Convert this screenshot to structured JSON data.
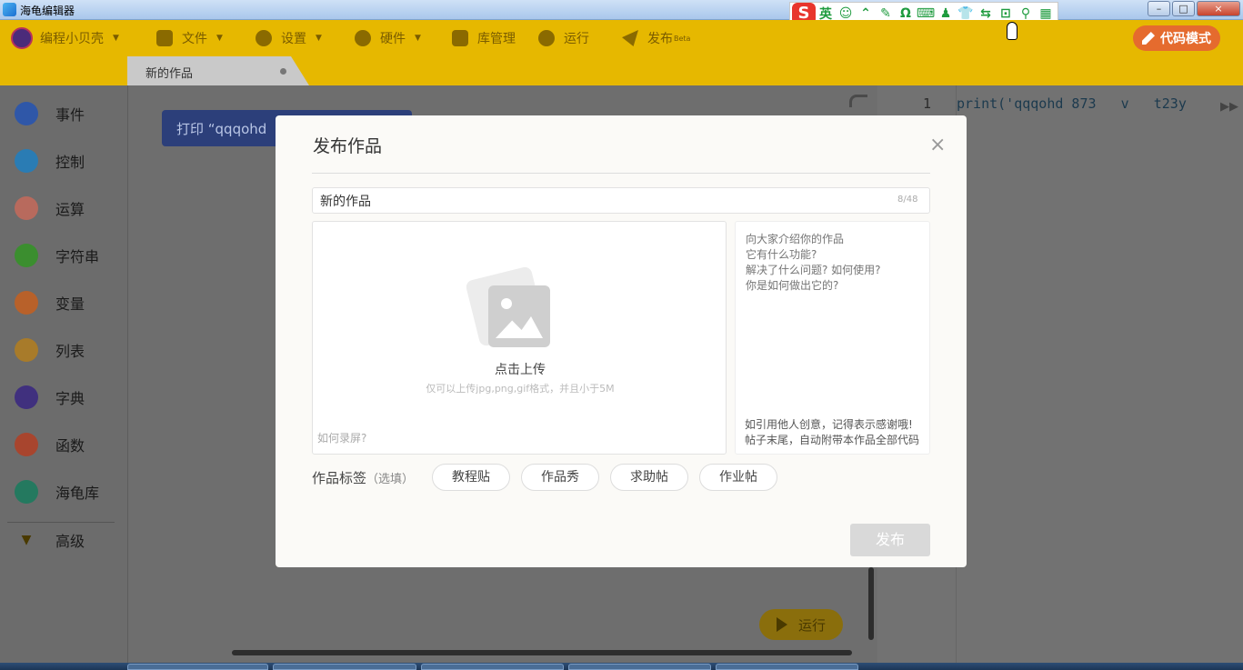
{
  "window": {
    "title": "海龟编辑器",
    "btn_min": "–",
    "btn_max": "□",
    "btn_close": "×"
  },
  "ime": {
    "logo": "S",
    "items": [
      "英",
      "☺",
      "⌃",
      "✎",
      "Ω",
      "⌨",
      "♟",
      "👕",
      "⇆",
      "⊡",
      "⚲",
      "▦"
    ]
  },
  "toolbar": {
    "user": "编程小贝壳",
    "file": "文件",
    "settings": "设置",
    "hardware": "硬件",
    "library": "库管理",
    "run": "运行",
    "publish": "发布",
    "publish_badge": "Beta",
    "code_mode": "代码模式",
    "accent": "#e6b800"
  },
  "tab": {
    "label": "新的作品"
  },
  "categories": [
    {
      "label": "事件",
      "color": "#2f57a8"
    },
    {
      "label": "控制",
      "color": "#2a7cb4"
    },
    {
      "label": "运算",
      "color": "#b86a5d"
    },
    {
      "label": "字符串",
      "color": "#3b8e2f"
    },
    {
      "label": "变量",
      "color": "#b8612a"
    },
    {
      "label": "列表",
      "color": "#a87b2a"
    },
    {
      "label": "字典",
      "color": "#40307e"
    },
    {
      "label": "函数",
      "color": "#a8452e"
    },
    {
      "label": "海龟库",
      "color": "#24795f"
    }
  ],
  "advanced": {
    "label": "高级"
  },
  "workspace": {
    "block_text": "打印 “qqqohd",
    "run_label": "运行"
  },
  "code": {
    "line": "1",
    "text": "print('qqqohd 873   v   t23y"
  },
  "modal": {
    "title": "发布作品",
    "close": "×",
    "title_value": "新的作品",
    "counter": "8/48",
    "upload_label": "点击上传",
    "upload_hint": "仅可以上传jpg,png,gif格式，并且小于5M",
    "record_link": "如何录屏?",
    "desc_placeholder": "向大家介绍你的作品\n它有什么功能?\n解决了什么问题? 如何使用?\n你是如何做出它的?",
    "desc_footer_1": "如引用他人创意，记得表示感谢哦!",
    "desc_footer_2": "帖子末尾，自动附带本作品全部代码",
    "tags_label": "作品标签",
    "tags_optional": "（选填）",
    "tags": [
      "教程贴",
      "作品秀",
      "求助帖",
      "作业帖"
    ],
    "publish": "发布"
  }
}
